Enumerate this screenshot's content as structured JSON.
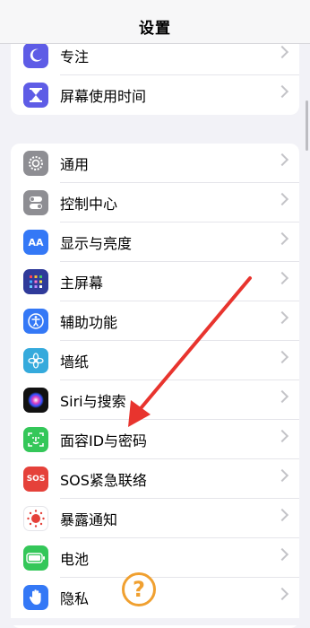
{
  "nav": {
    "title": "设置"
  },
  "group1": [
    {
      "label": "专注",
      "icon": "moon-icon",
      "color": "#5e5ce6"
    },
    {
      "label": "屏幕使用时间",
      "icon": "hourglass-icon",
      "color": "#5e5ce6"
    }
  ],
  "group2": [
    {
      "label": "通用",
      "icon": "gear-icon",
      "color": "#8e8e93"
    },
    {
      "label": "控制中心",
      "icon": "toggles-icon",
      "color": "#8e8e93"
    },
    {
      "label": "显示与亮度",
      "icon": "text-size-icon",
      "color": "#3478f6"
    },
    {
      "label": "主屏幕",
      "icon": "home-grid-icon",
      "color": "#3949ab"
    },
    {
      "label": "辅助功能",
      "icon": "accessibility-icon",
      "color": "#3478f6"
    },
    {
      "label": "墙纸",
      "icon": "flower-icon",
      "color": "#35aadc"
    },
    {
      "label": "Siri与搜索",
      "icon": "siri-icon",
      "color": "#222222"
    },
    {
      "label": "面容ID与密码",
      "icon": "face-id-icon",
      "color": "#34c759"
    },
    {
      "label": "SOS紧急联络",
      "icon": "sos-icon",
      "color": "#e5413a"
    },
    {
      "label": "暴露通知",
      "icon": "exposure-icon",
      "color": "#ffffff"
    },
    {
      "label": "电池",
      "icon": "battery-icon",
      "color": "#34c759"
    },
    {
      "label": "隐私",
      "icon": "hand-icon",
      "color": "#3478f6"
    }
  ],
  "icon_text": {
    "text_size": "AA",
    "sos": "SOS"
  },
  "help": {
    "label": "?"
  }
}
